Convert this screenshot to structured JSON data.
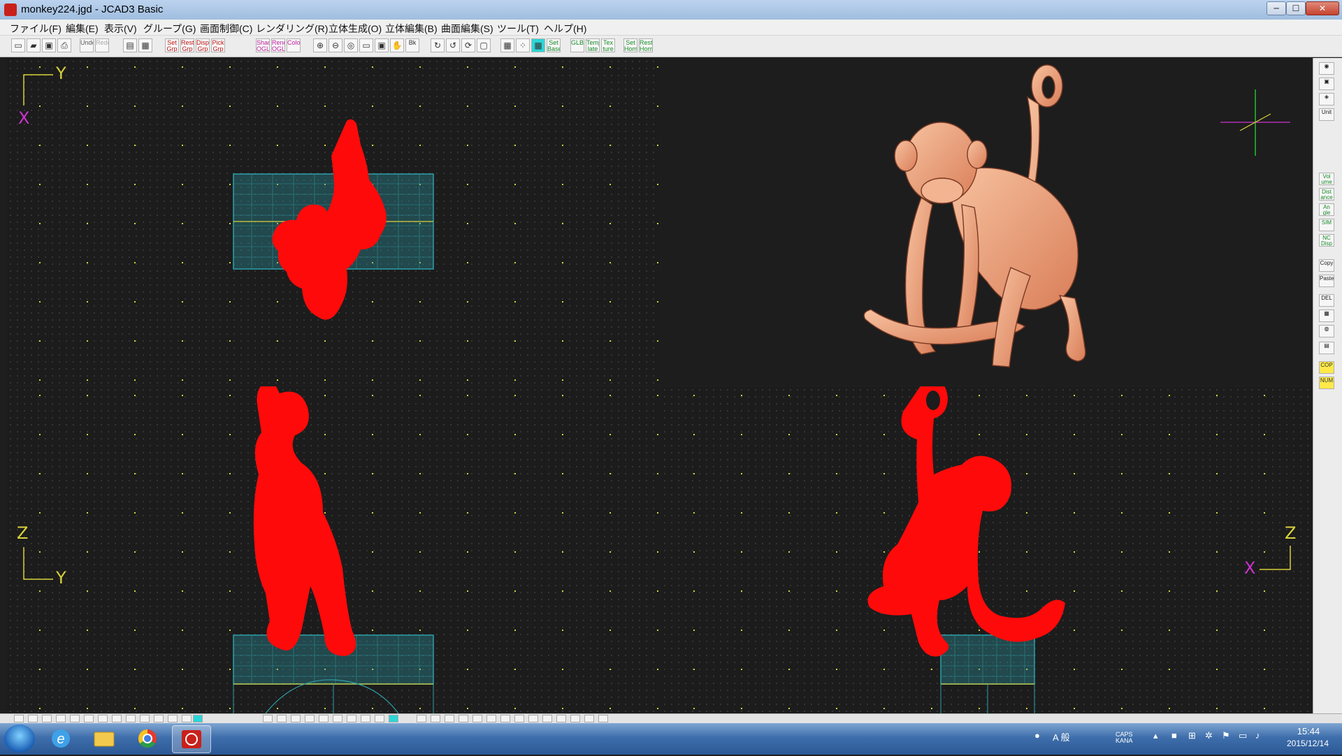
{
  "window": {
    "title": "monkey224.jgd - JCAD3 Basic",
    "buttons": {
      "minimize": "─",
      "maximize": "☐",
      "close": "✕"
    }
  },
  "menu": [
    "ファイル(F)",
    "編集(E)",
    "表示(V)",
    "グループ(G)",
    "画面制御(C)",
    "レンダリング(R)",
    "立体生成(O)",
    "立体編集(B)",
    "曲面編集(S)",
    "ツール(T)",
    "ヘルプ(H)"
  ],
  "toolbar": {
    "buttons": [
      {
        "label": "",
        "icon": "new-file-icon"
      },
      {
        "label": "",
        "icon": "open-folder-icon"
      },
      {
        "label": "",
        "icon": "save-icon"
      },
      {
        "label": "",
        "icon": "print-icon"
      },
      {
        "label": "Undo",
        "icon": "undo-icon"
      },
      {
        "label": "Redo",
        "icon": "redo-icon"
      },
      {
        "label": "",
        "icon": "layer-icon"
      },
      {
        "label": "",
        "icon": "layer2-icon"
      },
      {
        "label": "Set Grp",
        "icon": "set-group-icon"
      },
      {
        "label": "Rest Grp",
        "icon": "reset-group-icon"
      },
      {
        "label": "Disp Grp",
        "icon": "display-group-icon"
      },
      {
        "label": "Pick Grp",
        "icon": "pick-group-icon"
      },
      {
        "label": "Shad OGL",
        "icon": "shade-ogl-icon"
      },
      {
        "label": "Rend OGL",
        "icon": "render-ogl-icon"
      },
      {
        "label": "Color",
        "icon": "color-icon"
      },
      {
        "label": "",
        "icon": "zoom-in-icon"
      },
      {
        "label": "",
        "icon": "zoom-out-icon"
      },
      {
        "label": "",
        "icon": "zoom-fit-icon"
      },
      {
        "label": "",
        "icon": "zoom-window-icon"
      },
      {
        "label": "",
        "icon": "zoom-all-icon"
      },
      {
        "label": "",
        "icon": "pan-hand-icon"
      },
      {
        "label": "Bk",
        "icon": "back-view-icon"
      },
      {
        "label": "",
        "icon": "rotate-view-icon"
      },
      {
        "label": "",
        "icon": "rotate-view2-icon"
      },
      {
        "label": "",
        "icon": "rotate-view3-icon"
      },
      {
        "label": "",
        "icon": "frame-view-icon"
      },
      {
        "label": "",
        "icon": "grid-icon"
      },
      {
        "label": "",
        "icon": "grid-dots-icon"
      },
      {
        "label": "",
        "icon": "grid-cyan-icon"
      },
      {
        "label": "Set Base",
        "icon": "set-base-icon"
      },
      {
        "label": "GLB",
        "icon": "glb-icon"
      },
      {
        "label": "Temp late",
        "icon": "template-icon"
      },
      {
        "label": "Tex ture",
        "icon": "texture-icon"
      },
      {
        "label": "Set Home",
        "icon": "set-home-icon"
      },
      {
        "label": "Rest Home",
        "icon": "reset-home-icon"
      }
    ]
  },
  "viewports": {
    "top": {
      "axis_h": "Y",
      "axis_v": "X"
    },
    "front": {
      "axis_v": "Z",
      "axis_h": "Y"
    },
    "side": {
      "axis_v": "Z",
      "axis_h": "X"
    }
  },
  "palette": [
    "",
    "",
    "",
    "Unit",
    "Vol ume",
    "Dist ance",
    "An gle",
    "SIM",
    "NC Disp",
    "Copy",
    "Paste",
    "DEL",
    "",
    "",
    "",
    "COP",
    "NUM"
  ],
  "taskbar": {
    "tray_ime": "A 般",
    "tray_caps": "CAPS KANA",
    "time": "15:44",
    "date": "2015/12/14"
  },
  "colors": {
    "model_wire": "#ff0a0a",
    "model_rendered": "#f0a884",
    "grid_box": "#2d9fa9",
    "axis_yellow": "#d8d23a",
    "axis_magenta": "#cc33cc"
  }
}
